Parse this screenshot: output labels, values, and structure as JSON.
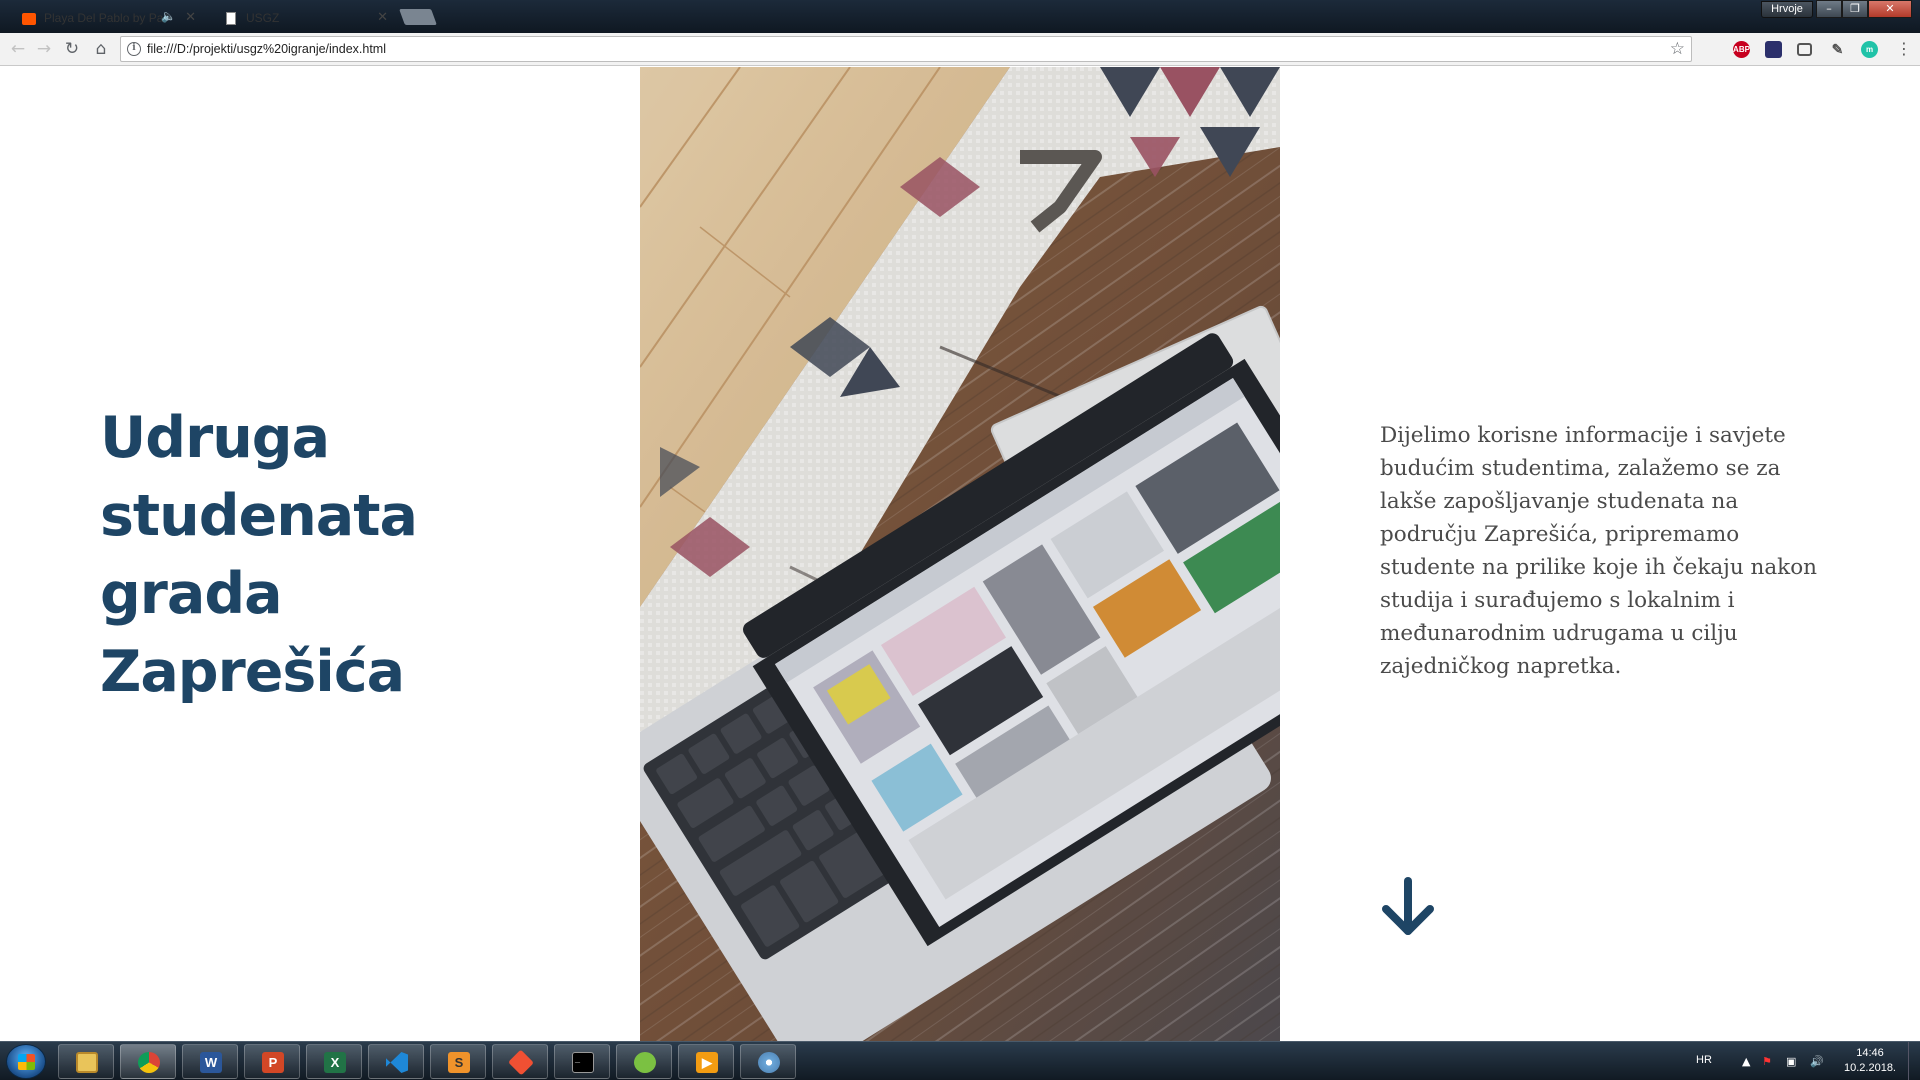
{
  "browser": {
    "tabs": [
      {
        "title": "Playa Del Pablo by Pa",
        "active": false,
        "audio": true
      },
      {
        "title": "USGZ",
        "active": true,
        "audio": false
      }
    ],
    "profile_name": "Hrvoje",
    "url": "file:///D:/projekti/usgz%20igranje/index.html",
    "extensions": [
      "adblock-plus-icon",
      "extension-icon",
      "screenshot-icon",
      "eyedropper-icon",
      "extension-m-icon"
    ],
    "abp_label": "ABP",
    "ext_m_label": "m"
  },
  "page": {
    "title_lines": [
      "Udruga",
      "studenata",
      "grada",
      "Zaprešića"
    ],
    "description": "Dijelimo korisne informacije i savjete budućim studentima, zalažemo se za lakše zapošljavanje studenata na području Zaprešića, pripremamo studente na prilike koje ih čekaju nakon studija i surađujemo s lokalnim i međunarodnim udrugama u cilju zajedničkog napretka.",
    "colors": {
      "title": "#1e4565",
      "text": "#4a4a4a",
      "arrow": "#1e4565"
    }
  },
  "taskbar": {
    "apps": [
      "explorer",
      "chrome",
      "word",
      "powerpoint",
      "excel",
      "vscode",
      "sublime-text",
      "git",
      "command-prompt",
      "utorrent",
      "media-player",
      "paint"
    ],
    "word_letter": "W",
    "powerpoint_letter": "P",
    "excel_letter": "X",
    "sublime_letter": "S",
    "language": "HR",
    "time": "14:46",
    "date": "10.2.2018."
  }
}
